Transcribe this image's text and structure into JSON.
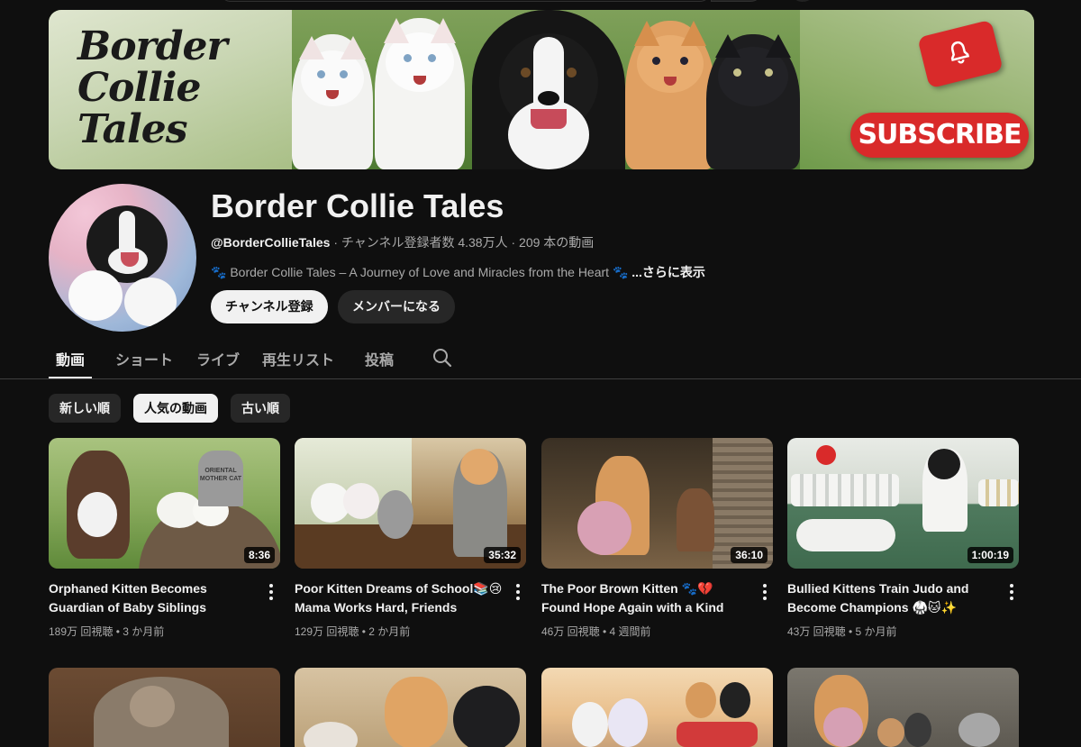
{
  "banner": {
    "logo_lines": [
      "Border",
      "Collie",
      "Tales"
    ],
    "subscribe_label": "SUBSCRIBE"
  },
  "channel": {
    "title": "Border Collie Tales",
    "handle": "@BorderCollieTales",
    "stats": " · チャンネル登録者数 4.38万人 · 209 本の動画",
    "description": "🐾 Border Collie Tales – A Journey of Love and Miracles from the Heart 🐾",
    "more_label": "...さらに表示",
    "subscribe_button": "チャンネル登録",
    "member_button": "メンバーになる"
  },
  "tabs": [
    {
      "label": "動画",
      "active": true
    },
    {
      "label": "ショート",
      "active": false
    },
    {
      "label": "ライブ",
      "active": false
    },
    {
      "label": "再生リスト",
      "active": false
    },
    {
      "label": "投稿",
      "active": false
    }
  ],
  "chips": [
    {
      "label": "新しい順",
      "active": false
    },
    {
      "label": "人気の動画",
      "active": true
    },
    {
      "label": "古い順",
      "active": false
    }
  ],
  "videos": [
    {
      "title": "Orphaned Kitten Becomes Guardian of Baby Siblings",
      "duration": "8:36",
      "meta": "189万 回視聴 • 3 か月前",
      "thumb_text": "ORIENTAL MOTHER CAT"
    },
    {
      "title": "Poor Kitten Dreams of School📚😢 Mama Works Hard, Friends Rescu…",
      "duration": "35:32",
      "meta": "129万 回視聴 • 2 か月前"
    },
    {
      "title": "The Poor Brown Kitten 🐾💔 Found Hope Again with a Kind Mama Cat…",
      "duration": "36:10",
      "meta": "46万 回視聴 • 4 週間前"
    },
    {
      "title": "Bullied Kittens Train Judo and Become Champions 🥋🐱✨",
      "duration": "1:00:19",
      "meta": "43万 回視聴 • 5 か月前"
    }
  ],
  "colors": {
    "background": "#0f0f0f",
    "text_primary": "#f1f1f1",
    "text_secondary": "#aaaaaa",
    "chip_bg": "#272727",
    "brand_red": "#d92a2a"
  }
}
